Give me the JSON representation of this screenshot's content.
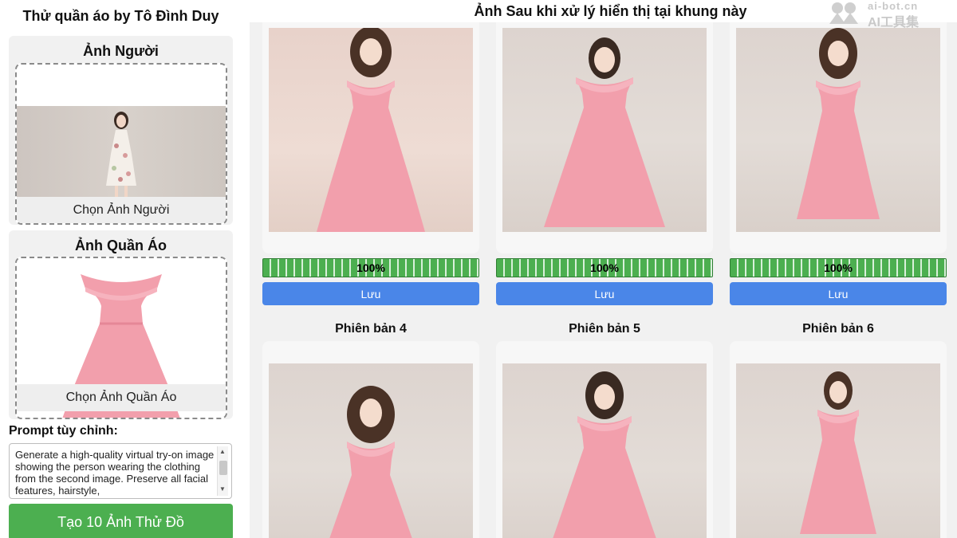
{
  "app": {
    "title": "Thử quần áo by Tô Đình Duy"
  },
  "person_panel": {
    "title": "Ảnh Người",
    "choose_label": "Chọn Ảnh Người"
  },
  "garment_panel": {
    "title": "Ảnh Quần Áo",
    "choose_label": "Chọn Ảnh Quần Áo"
  },
  "prompt": {
    "label": "Prompt tùy chỉnh:",
    "value": "Generate a high-quality virtual try-on image showing the person wearing the clothing from the second image. Preserve all facial features, hairstyle,"
  },
  "generate_button": {
    "label": "Tạo 10 Ảnh Thử Đồ"
  },
  "main": {
    "title": "Ảnh Sau khi xử lý hiển thị tại khung này",
    "results_top": [
      {
        "progress": "100%",
        "save_label": "Lưu"
      },
      {
        "progress": "100%",
        "save_label": "Lưu"
      },
      {
        "progress": "100%",
        "save_label": "Lưu"
      }
    ],
    "versions": [
      {
        "title": "Phiên bản 4"
      },
      {
        "title": "Phiên bản 5"
      },
      {
        "title": "Phiên bản 6"
      }
    ]
  },
  "watermark": {
    "line1": "ai-bot.cn",
    "line2": "AI工具集"
  },
  "colors": {
    "generate": "#4caf50",
    "save": "#4a86e8",
    "progress": "#4caf50",
    "dress": "#f29fac"
  }
}
